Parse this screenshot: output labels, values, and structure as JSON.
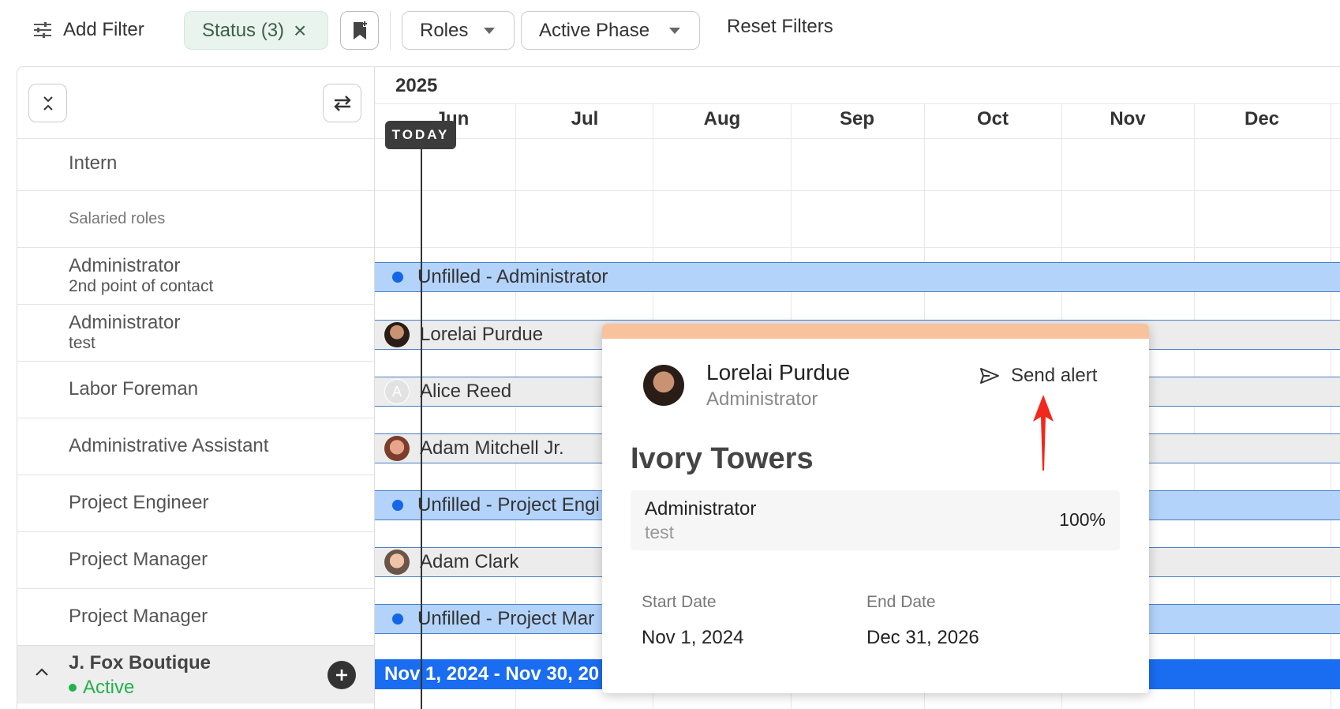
{
  "toolbar": {
    "add_filter": "Add Filter",
    "status_chip": "Status (3)",
    "roles": "Roles",
    "active_phase": "Active Phase",
    "reset_filters": "Reset Filters"
  },
  "left_rows": [
    {
      "title": "Intern"
    },
    {
      "title": "Salaried roles"
    },
    {
      "title": "Administrator",
      "subtitle": "2nd point of contact"
    },
    {
      "title": "Administrator",
      "subtitle": "test"
    },
    {
      "title": "Labor Foreman"
    },
    {
      "title": "Administrative Assistant"
    },
    {
      "title": "Project Engineer"
    },
    {
      "title": "Project Manager"
    },
    {
      "title": "Project Manager"
    }
  ],
  "project": {
    "name": "J. Fox Boutique",
    "status": "Active",
    "status_color": "#22b14c"
  },
  "timeline": {
    "year": "2025",
    "today_label": "TODAY",
    "months": [
      "Jun",
      "Jul",
      "Aug",
      "Sep",
      "Oct",
      "Nov",
      "Dec"
    ]
  },
  "bars": [
    {
      "label": "Unfilled - Administrator",
      "kind": "unfilled"
    },
    {
      "label": "Lorelai Purdue",
      "kind": "person"
    },
    {
      "label": "Alice Reed",
      "kind": "person",
      "initial": "A"
    },
    {
      "label": "Adam Mitchell Jr.",
      "kind": "person"
    },
    {
      "label": "Unfilled - Project Engi",
      "kind": "unfilled"
    },
    {
      "label": "Adam Clark",
      "kind": "person"
    },
    {
      "label": "Unfilled - Project Mar",
      "kind": "unfilled"
    }
  ],
  "project_bar": "Nov 1, 2024 - Nov 30, 20",
  "popup": {
    "name": "Lorelai Purdue",
    "role": "Administrator",
    "send_alert": "Send alert",
    "project": "Ivory Towers",
    "assignment_role": "Administrator",
    "assignment_sub": "test",
    "allocation": "100%",
    "start_label": "Start Date",
    "start_value": "Nov 1, 2024",
    "end_label": "End Date",
    "end_value": "Dec 31, 2026",
    "accent_color": "#f8c29c"
  },
  "colors": {
    "unfilled_bar": "#b3d3fb",
    "person_bar": "#ececec",
    "project_bar": "#1a6cf0",
    "annotation_arrow": "#f0281e"
  }
}
